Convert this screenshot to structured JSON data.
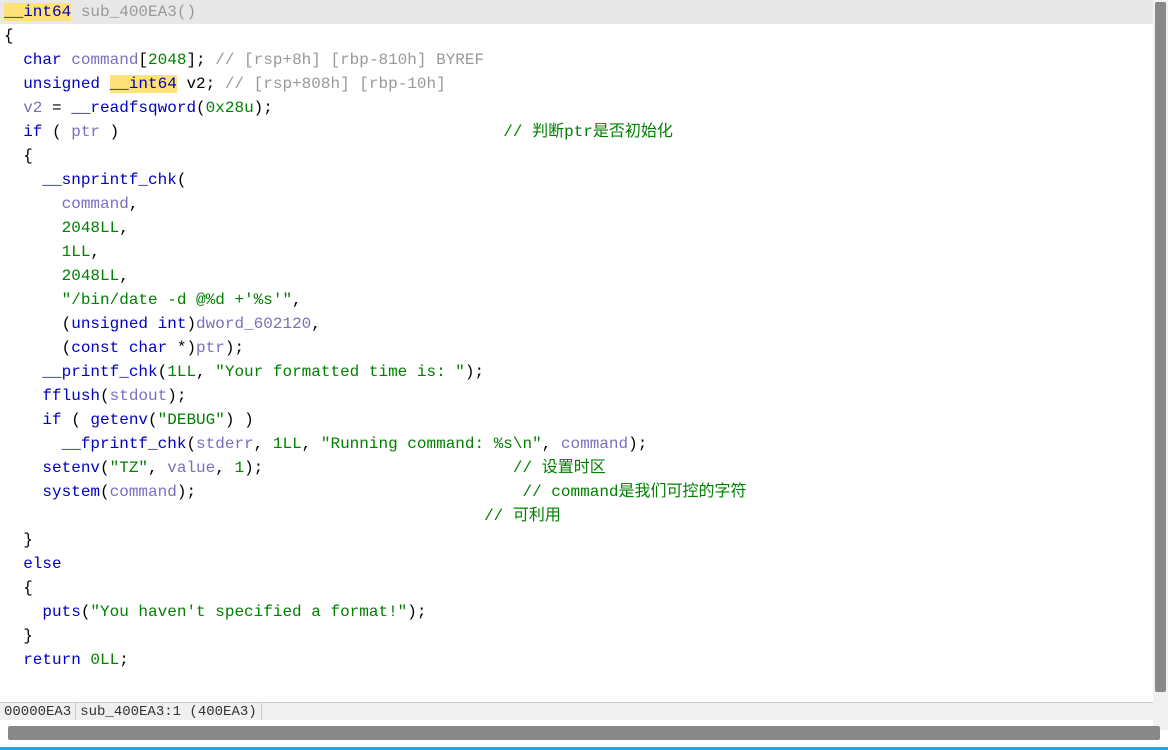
{
  "code": {
    "l1a": "__int64",
    "l1b": " sub_400EA3",
    "l1c": "()",
    "l2": "{",
    "l3a": "  char",
    "l3b": " command",
    "l3c": "[",
    "l3d": "2048",
    "l3e": "]; ",
    "l3f": "// [rsp+8h] [rbp-810h] BYREF",
    "l4a": "  unsigned ",
    "l4b": "__int64",
    "l4c": " v2; ",
    "l4d": "// [rsp+808h] [rbp-10h]",
    "l5": "",
    "l6a": "  v2 ",
    "l6b": "= ",
    "l6c": "__readfsqword",
    "l6d": "(",
    "l6e": "0x28u",
    "l6f": ");",
    "l7a": "  if",
    "l7b": " ( ",
    "l7c": "ptr",
    "l7d": " )                                        ",
    "l7e": "// 判断ptr是否初始化",
    "l8": "  {",
    "l9a": "    __snprintf_chk",
    "l9b": "(",
    "l10a": "      command",
    "l10b": ",",
    "l11a": "      ",
    "l11b": "2048LL",
    "l11c": ",",
    "l12a": "      ",
    "l12b": "1LL",
    "l12c": ",",
    "l13a": "      ",
    "l13b": "2048LL",
    "l13c": ",",
    "l14a": "      ",
    "l14b": "\"/bin/date -d @%d +'%s'\"",
    "l14c": ",",
    "l15a": "      (",
    "l15b": "unsigned int",
    "l15c": ")",
    "l15d": "dword_602120",
    "l15e": ",",
    "l16a": "      (",
    "l16b": "const char",
    "l16c": " *)",
    "l16d": "ptr",
    "l16e": ");",
    "l17a": "    __printf_chk",
    "l17b": "(",
    "l17c": "1LL",
    "l17d": ", ",
    "l17e": "\"Your formatted time is: \"",
    "l17f": ");",
    "l18a": "    fflush",
    "l18b": "(",
    "l18c": "stdout",
    "l18d": ");",
    "l19a": "    if",
    "l19b": " ( ",
    "l19c": "getenv",
    "l19d": "(",
    "l19e": "\"DEBUG\"",
    "l19f": ") )",
    "l20a": "      __fprintf_chk",
    "l20b": "(",
    "l20c": "stderr",
    "l20d": ", ",
    "l20e": "1LL",
    "l20f": ", ",
    "l20g": "\"Running command: %s\\n\"",
    "l20h": ", ",
    "l20i": "command",
    "l20j": ");",
    "l21a": "    setenv",
    "l21b": "(",
    "l21c": "\"TZ\"",
    "l21d": ", ",
    "l21e": "value",
    "l21f": ", ",
    "l21g": "1",
    "l21h": ");                          ",
    "l21i": "// 设置时区",
    "l22a": "    system",
    "l22b": "(",
    "l22c": "command",
    "l22d": ");                                  ",
    "l22e": "// command是我们可控的字符",
    "l23a": "                                                  ",
    "l23b": "// 可利用",
    "l24": "  }",
    "l25a": "  else",
    "l26": "  {",
    "l27a": "    puts",
    "l27b": "(",
    "l27c": "\"You haven't specified a format!\"",
    "l27d": ");",
    "l28": "  }",
    "l29a": "  return",
    "l29b": " ",
    "l29c": "0LL",
    "l29d": ";"
  },
  "status": {
    "addr": "00000EA3",
    "loc": "sub_400EA3:1 (400EA3)"
  }
}
